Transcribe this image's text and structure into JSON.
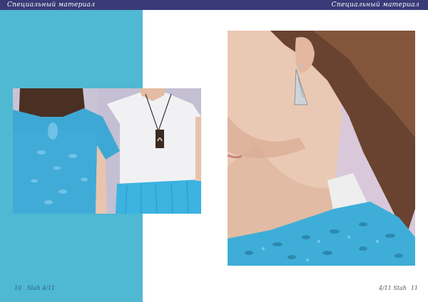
{
  "header": {
    "left_title": "Специальный материал",
    "right_title": "Специальный материал"
  },
  "footer": {
    "left_page": "10",
    "left_label": "Stah 4/11",
    "right_label": "4/11 Stah",
    "right_page": "11"
  },
  "colors": {
    "header_bar": "#3a3a78",
    "accent_panel": "#4fb8d3",
    "page_background": "#ffffff"
  }
}
